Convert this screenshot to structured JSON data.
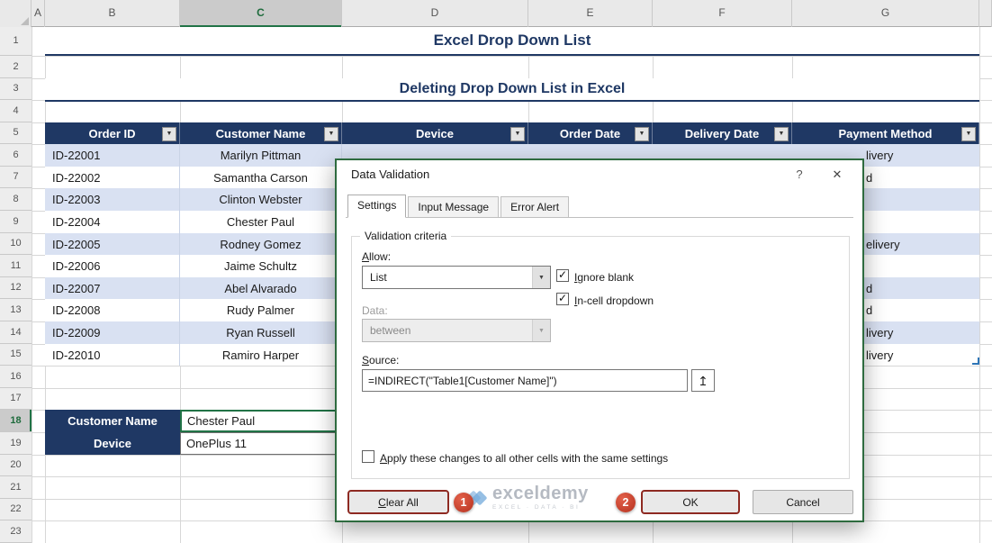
{
  "spreadsheet": {
    "column_headers": [
      "A",
      "B",
      "C",
      "D",
      "E",
      "F",
      "G"
    ],
    "row_headers": [
      "1",
      "2",
      "3",
      "4",
      "5",
      "6",
      "7",
      "8",
      "9",
      "10",
      "11",
      "12",
      "13",
      "14",
      "15",
      "16",
      "17",
      "18",
      "19",
      "20",
      "21",
      "22",
      "23"
    ],
    "selected_column": "C",
    "selected_row": "18",
    "banner_title": "Excel Drop Down List",
    "section_title": "Deleting Drop Down List in Excel",
    "table": {
      "headers": [
        "Order ID",
        "Customer Name",
        "Device",
        "Order Date",
        "Delivery Date",
        "Payment Method"
      ],
      "rows": [
        {
          "order_id": "ID-22001",
          "customer": "Marilyn Pittman",
          "payment_fragment": "livery"
        },
        {
          "order_id": "ID-22002",
          "customer": "Samantha Carson",
          "payment_fragment": "d"
        },
        {
          "order_id": "ID-22003",
          "customer": "Clinton Webster",
          "payment_fragment": ""
        },
        {
          "order_id": "ID-22004",
          "customer": "Chester Paul",
          "payment_fragment": ""
        },
        {
          "order_id": "ID-22005",
          "customer": "Rodney Gomez",
          "payment_fragment": "elivery"
        },
        {
          "order_id": "ID-22006",
          "customer": "Jaime Schultz",
          "payment_fragment": ""
        },
        {
          "order_id": "ID-22007",
          "customer": "Abel Alvarado",
          "payment_fragment": "d"
        },
        {
          "order_id": "ID-22008",
          "customer": "Rudy Palmer",
          "payment_fragment": "d"
        },
        {
          "order_id": "ID-22009",
          "customer": "Ryan Russell",
          "payment_fragment": "livery"
        },
        {
          "order_id": "ID-22010",
          "customer": "Ramiro Harper",
          "payment_fragment": "livery"
        }
      ]
    },
    "lookup": {
      "customer_label": "Customer Name",
      "customer_value": "Chester Paul",
      "device_label": "Device",
      "device_value": "OnePlus 11"
    }
  },
  "dialog": {
    "title": "Data Validation",
    "help_icon": "?",
    "close_icon": "✕",
    "tabs": [
      "Settings",
      "Input Message",
      "Error Alert"
    ],
    "active_tab": "Settings",
    "group_label": "Validation criteria",
    "allow_label": "Allow:",
    "allow_value": "List",
    "ignore_blank_label": "Ignore blank",
    "in_cell_label": "In-cell dropdown",
    "data_label": "Data:",
    "data_value": "between",
    "source_label": "Source:",
    "source_value": "=INDIRECT(\"Table1[Customer Name]\")",
    "apply_label": "Apply these changes to all other cells with the same settings",
    "clear_all_label": "Clear All",
    "ok_label": "OK",
    "cancel_label": "Cancel"
  },
  "annotations": {
    "step1": "1",
    "step2": "2"
  },
  "watermark": {
    "brand": "exceldemy",
    "tagline": "EXCEL · DATA · BI"
  },
  "icons": {
    "filter": "▼",
    "combo_chevron": "▼",
    "check": "✓",
    "range_selector": "↥"
  },
  "colors": {
    "header_navy": "#1F3864",
    "band_blue": "#D9E1F2",
    "selection_green": "#217346",
    "badge_red": "#C9402F",
    "highlight_border_red": "#8E2A22"
  }
}
